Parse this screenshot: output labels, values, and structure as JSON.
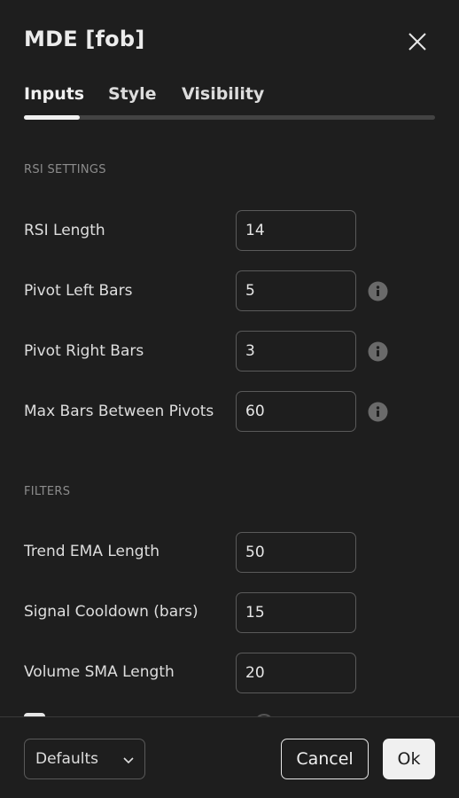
{
  "header": {
    "title": "MDE [fob]",
    "close_icon": "close-icon"
  },
  "tabs": [
    {
      "label": "Inputs",
      "active": true
    },
    {
      "label": "Style",
      "active": false
    },
    {
      "label": "Visibility",
      "active": false
    }
  ],
  "sections": {
    "rsi_settings": {
      "label": "RSI SETTINGS",
      "rows": [
        {
          "label": "RSI Length",
          "value": "14",
          "info": false
        },
        {
          "label": "Pivot Left Bars",
          "value": "5",
          "info": true
        },
        {
          "label": "Pivot Right Bars",
          "value": "3",
          "info": true
        },
        {
          "label": "Max Bars Between Pivots",
          "value": "60",
          "info": true
        }
      ]
    },
    "filters": {
      "label": "FILTERS",
      "rows": [
        {
          "label": "Trend EMA Length",
          "value": "50"
        },
        {
          "label": "Signal Cooldown (bars)",
          "value": "15"
        },
        {
          "label": "Volume SMA Length",
          "value": "20"
        }
      ]
    }
  },
  "footer": {
    "defaults_label": "Defaults",
    "cancel_label": "Cancel",
    "ok_label": "Ok"
  },
  "colors": {
    "background": "#1e1e1e",
    "text": "#dbdbdb",
    "muted": "#8c8c8c",
    "border": "#5a5a5a",
    "accent": "#f0f0f0"
  }
}
